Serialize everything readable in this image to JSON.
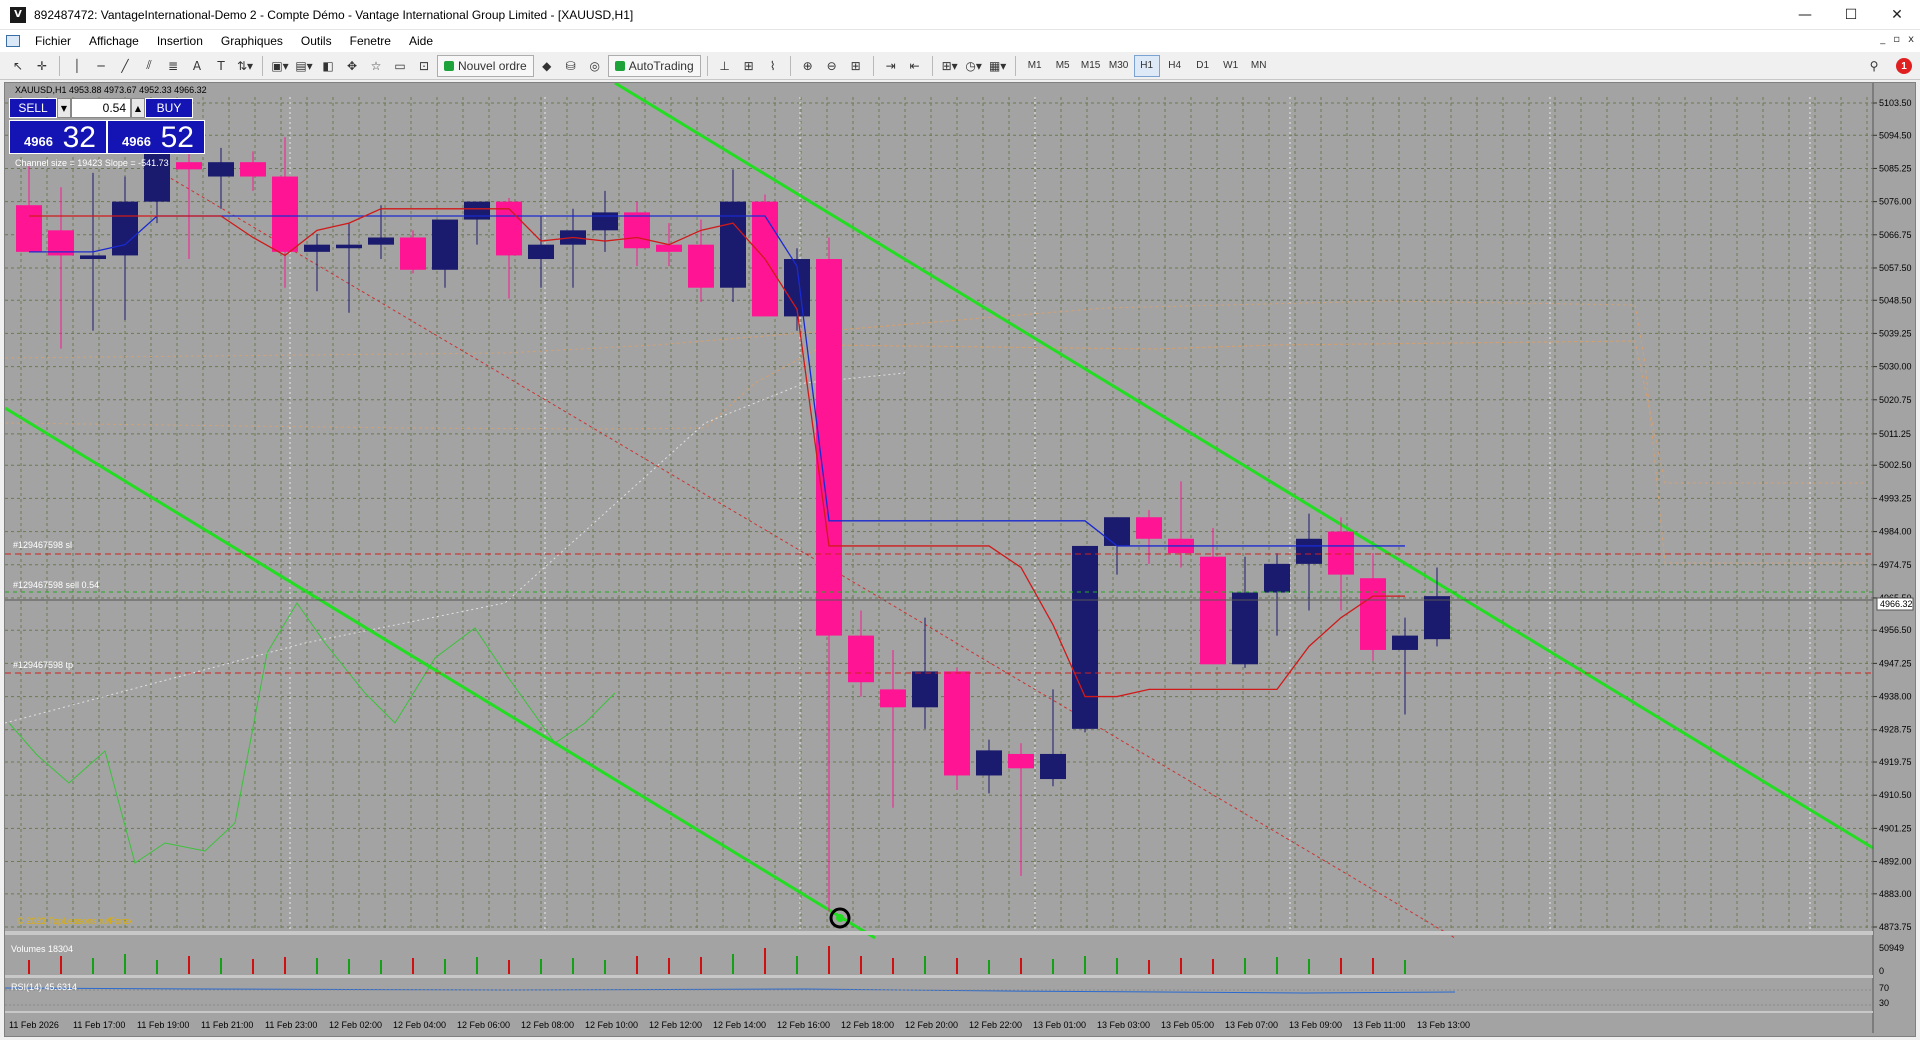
{
  "window": {
    "title": "892487472: VantageInternational-Demo 2 - Compte Démo - Vantage International Group Limited - [XAUUSD,H1]",
    "app_icon_letter": "V",
    "controls": {
      "minimize": "—",
      "maximize": "☐",
      "close": "✕"
    }
  },
  "menu": {
    "items": [
      "Fichier",
      "Affichage",
      "Insertion",
      "Graphiques",
      "Outils",
      "Fenetre",
      "Aide"
    ],
    "mdi_controls": {
      "minimize": "_",
      "restore": "▫",
      "close": "x"
    }
  },
  "toolbar": {
    "new_order": "Nouvel ordre",
    "autotrading": "AutoTrading",
    "timeframes": [
      "M1",
      "M5",
      "M15",
      "M30",
      "H1",
      "H4",
      "D1",
      "W1",
      "MN"
    ],
    "active_timeframe": "H1",
    "notification_count": "1"
  },
  "chart": {
    "header": "XAUUSD,H1  4953.88 4973.67 4952.33 4966.32",
    "channel_info": "Channel size = 19423  Slope = -541.73",
    "watermark": "© 2023 TopLessons.ru/Forex",
    "current_price_label": "4966.32",
    "price_axis": [
      "5103.50",
      "5094.50",
      "5085.25",
      "5076.00",
      "5066.75",
      "5057.50",
      "5048.50",
      "5039.25",
      "5030.00",
      "5020.75",
      "5011.25",
      "5002.50",
      "4993.25",
      "4984.00",
      "4974.75",
      "4965.50",
      "4956.50",
      "4947.25",
      "4938.00",
      "4928.75",
      "4919.75",
      "4910.50",
      "4901.25",
      "4892.00",
      "4883.00",
      "4873.75"
    ],
    "order_lines": {
      "sl": "#129467598 sl",
      "entry": "#129467598 sell 0.54",
      "tp": "#129467598 tp"
    },
    "volumes_label": "Volumes 18304",
    "volumes_axis": {
      "max": "50949",
      "min": "0"
    },
    "rsi_label": "RSI(14) 45.6314",
    "rsi_axis": {
      "top": "70",
      "bottom": "30"
    },
    "time_axis": [
      "11 Feb 2026",
      "11 Feb 17:00",
      "11 Feb 19:00",
      "11 Feb 21:00",
      "11 Feb 23:00",
      "12 Feb 02:00",
      "12 Feb 04:00",
      "12 Feb 06:00",
      "12 Feb 08:00",
      "12 Feb 10:00",
      "12 Feb 12:00",
      "12 Feb 14:00",
      "12 Feb 16:00",
      "12 Feb 18:00",
      "12 Feb 20:00",
      "12 Feb 22:00",
      "13 Feb 01:00",
      "13 Feb 03:00",
      "13 Feb 05:00",
      "13 Feb 07:00",
      "13 Feb 09:00",
      "13 Feb 11:00",
      "13 Feb 13:00"
    ]
  },
  "one_click": {
    "sell_label": "SELL",
    "buy_label": "BUY",
    "lot": "0.54",
    "sell_price_small": "4966",
    "sell_price_big": "32",
    "buy_price_small": "4966",
    "buy_price_big": "52"
  },
  "colors": {
    "chart_bg": "#a3a3a3",
    "bull_candle": "#1a1a6e",
    "bear_candle": "#ff1493",
    "channel_line": "#22dd22",
    "stop_line": "#cc2222",
    "grid": "#6b7a52"
  },
  "chart_data": {
    "type": "candlestick",
    "symbol": "XAUUSD",
    "timeframe": "H1",
    "ylim": [
      4873.75,
      5103.5
    ],
    "candles": [
      {
        "o": 5075,
        "h": 5086,
        "l": 5064,
        "c": 5062
      },
      {
        "o": 5068,
        "h": 5080,
        "l": 5035,
        "c": 5061
      },
      {
        "o": 5060,
        "h": 5084,
        "l": 5040,
        "c": 5061
      },
      {
        "o": 5061,
        "h": 5083,
        "l": 5043,
        "c": 5076
      },
      {
        "o": 5076,
        "h": 5093,
        "l": 5070,
        "c": 5090
      },
      {
        "o": 5087,
        "h": 5090,
        "l": 5060,
        "c": 5085
      },
      {
        "o": 5083,
        "h": 5091,
        "l": 5074,
        "c": 5087
      },
      {
        "o": 5087,
        "h": 5090,
        "l": 5079,
        "c": 5083
      },
      {
        "o": 5083,
        "h": 5094,
        "l": 5052,
        "c": 5062
      },
      {
        "o": 5062,
        "h": 5067,
        "l": 5051,
        "c": 5064
      },
      {
        "o": 5063,
        "h": 5070,
        "l": 5045,
        "c": 5064
      },
      {
        "o": 5064,
        "h": 5075,
        "l": 5060,
        "c": 5066
      },
      {
        "o": 5066,
        "h": 5068,
        "l": 5056,
        "c": 5057
      },
      {
        "o": 5057,
        "h": 5070,
        "l": 5052,
        "c": 5071
      },
      {
        "o": 5071,
        "h": 5076,
        "l": 5064,
        "c": 5076
      },
      {
        "o": 5076,
        "h": 5077,
        "l": 5049,
        "c": 5061
      },
      {
        "o": 5060,
        "h": 5072,
        "l": 5052,
        "c": 5064
      },
      {
        "o": 5064,
        "h": 5074,
        "l": 5052,
        "c": 5068
      },
      {
        "o": 5068,
        "h": 5079,
        "l": 5062,
        "c": 5073
      },
      {
        "o": 5073,
        "h": 5076,
        "l": 5058,
        "c": 5063
      },
      {
        "o": 5064,
        "h": 5070,
        "l": 5058,
        "c": 5062
      },
      {
        "o": 5064,
        "h": 5071,
        "l": 5048,
        "c": 5052
      },
      {
        "o": 5052,
        "h": 5085,
        "l": 5048,
        "c": 5076
      },
      {
        "o": 5076,
        "h": 5078,
        "l": 5044,
        "c": 5044
      },
      {
        "o": 5044,
        "h": 5063,
        "l": 5040,
        "c": 5060
      },
      {
        "o": 5060,
        "h": 5066,
        "l": 4878,
        "c": 4955
      },
      {
        "o": 4955,
        "h": 4962,
        "l": 4938,
        "c": 4942
      },
      {
        "o": 4940,
        "h": 4951,
        "l": 4907,
        "c": 4935
      },
      {
        "o": 4935,
        "h": 4960,
        "l": 4929,
        "c": 4945
      },
      {
        "o": 4945,
        "h": 4946,
        "l": 4912,
        "c": 4916
      },
      {
        "o": 4916,
        "h": 4926,
        "l": 4911,
        "c": 4923
      },
      {
        "o": 4922,
        "h": 4925,
        "l": 4888,
        "c": 4918
      },
      {
        "o": 4915,
        "h": 4940,
        "l": 4913,
        "c": 4922
      },
      {
        "o": 4929,
        "h": 4980,
        "l": 4928,
        "c": 4980
      },
      {
        "o": 4980,
        "h": 4988,
        "l": 4972,
        "c": 4988
      },
      {
        "o": 4988,
        "h": 4990,
        "l": 4975,
        "c": 4982
      },
      {
        "o": 4982,
        "h": 4998,
        "l": 4974,
        "c": 4978
      },
      {
        "o": 4977,
        "h": 4985,
        "l": 4947,
        "c": 4947
      },
      {
        "o": 4947,
        "h": 4977,
        "l": 4946,
        "c": 4967
      },
      {
        "o": 4967,
        "h": 4978,
        "l": 4955,
        "c": 4975
      },
      {
        "o": 4975,
        "h": 4989,
        "l": 4962,
        "c": 4982
      },
      {
        "o": 4984,
        "h": 4988,
        "l": 4962,
        "c": 4972
      },
      {
        "o": 4971,
        "h": 4978,
        "l": 4948,
        "c": 4951
      },
      {
        "o": 4951,
        "h": 4960,
        "l": 4933,
        "c": 4955
      },
      {
        "o": 4954,
        "h": 4974,
        "l": 4952,
        "c": 4966
      }
    ]
  }
}
